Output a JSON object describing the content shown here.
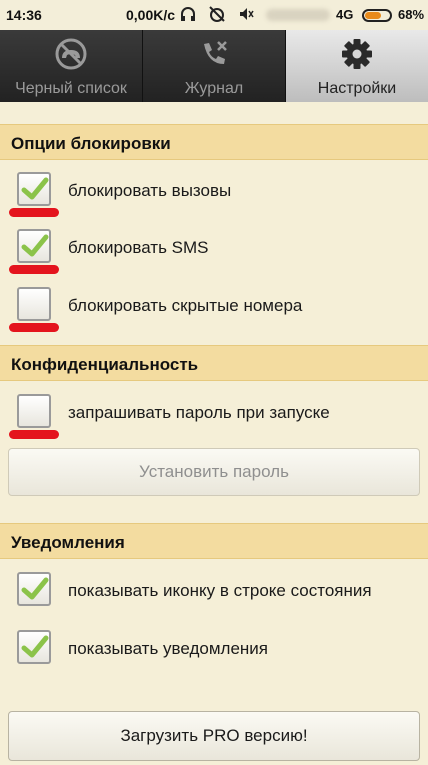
{
  "status_bar": {
    "time": "14:36",
    "speed": "0,00K/c",
    "network": "4G",
    "battery_percent": "68%",
    "battery_level": 0.68,
    "battery_color": "#e88a1a"
  },
  "tabs": [
    {
      "label": "Черный список",
      "icon": "blocked-phone-icon",
      "active": false
    },
    {
      "label": "Журнал",
      "icon": "call-log-icon",
      "active": false
    },
    {
      "label": "Настройки",
      "icon": "gear-icon",
      "active": true
    }
  ],
  "sections": {
    "blocking": {
      "title": "Опции блокировки",
      "items": [
        {
          "label": "блокировать вызовы",
          "checked": true
        },
        {
          "label": "блокировать SMS",
          "checked": true
        },
        {
          "label": "блокировать скрытые номера",
          "checked": false
        }
      ]
    },
    "privacy": {
      "title": "Конфиденциальность",
      "items": [
        {
          "label": "запрашивать пароль при запуске",
          "checked": false
        }
      ],
      "set_password_button": "Установить пароль"
    },
    "notifications": {
      "title": "Уведомления",
      "items": [
        {
          "label": "показывать иконку в строке состояния",
          "checked": true
        },
        {
          "label": "показывать уведомления",
          "checked": true
        }
      ]
    }
  },
  "pro_button": "Загрузить PRO версию!",
  "colors": {
    "section_header": "#f3dca0",
    "background": "#f5efd7",
    "check_green": "#8bc34a",
    "annotation_red": "#e4141d"
  }
}
